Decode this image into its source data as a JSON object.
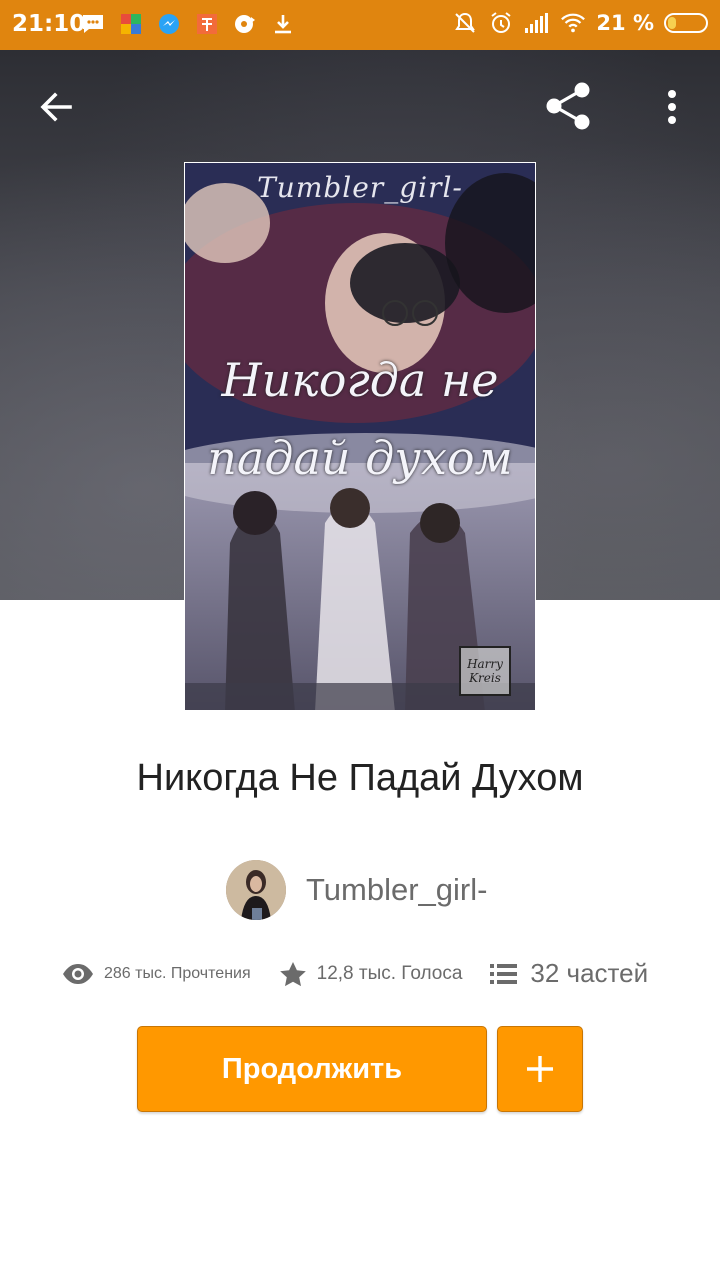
{
  "status_bar": {
    "time": "21:10",
    "battery_text": "21 %",
    "battery_level_percent": 21,
    "left_icons": [
      "message-icon",
      "kite-icon",
      "messenger-icon",
      "gift-icon",
      "disc-icon",
      "download-icon"
    ],
    "right_icons": [
      "bell-off-icon",
      "alarm-icon",
      "signal-icon",
      "wifi-icon",
      "battery-icon"
    ]
  },
  "toolbar": {
    "back_icon": "arrow-left-icon",
    "share_icon": "share-icon",
    "more_icon": "more-vertical-icon"
  },
  "cover": {
    "author_text": "Tumbler_girl-",
    "title_line_1": "Никогда не",
    "title_line_2": "падай духом",
    "stamp_line_1": "Harry",
    "stamp_line_2": "Kreis"
  },
  "book": {
    "title": "Никогда Не Падай Духом",
    "author": "Tumbler_girl-"
  },
  "stats": {
    "reads": "286 тыс. Прочтения",
    "votes": "12,8 тыс. Голоса",
    "parts": "32 частей"
  },
  "actions": {
    "continue_label": "Продолжить",
    "add_icon": "plus-icon"
  },
  "colors": {
    "status_bar": "#e0850f",
    "accent": "#ff9800",
    "text_primary": "#222222",
    "text_secondary": "#6b6b6b"
  }
}
